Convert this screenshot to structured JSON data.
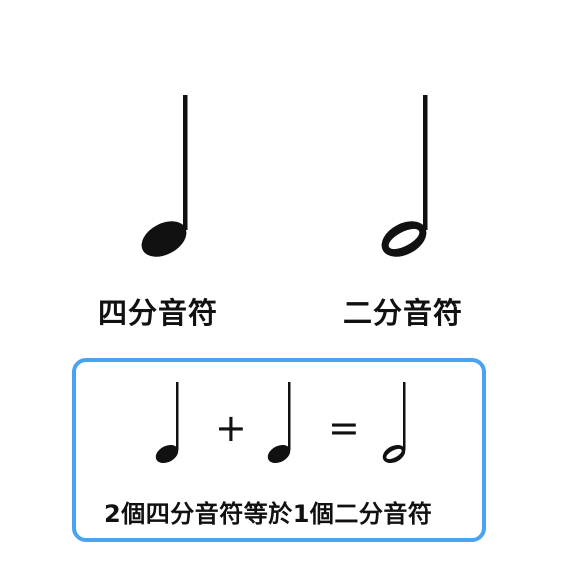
{
  "notes": {
    "quarter_label": "四分音符",
    "half_label": "二分音符"
  },
  "equation": {
    "plus": "+",
    "equals": "=",
    "caption": "2個四分音符等於1個二分音符"
  },
  "colors": {
    "box_border": "#4aa3ef",
    "ink": "#111111"
  },
  "icons": {
    "large_quarter": "quarter-note-icon",
    "large_half": "half-note-icon",
    "small_quarter_1": "quarter-note-icon",
    "small_quarter_2": "quarter-note-icon",
    "small_half": "half-note-icon"
  }
}
